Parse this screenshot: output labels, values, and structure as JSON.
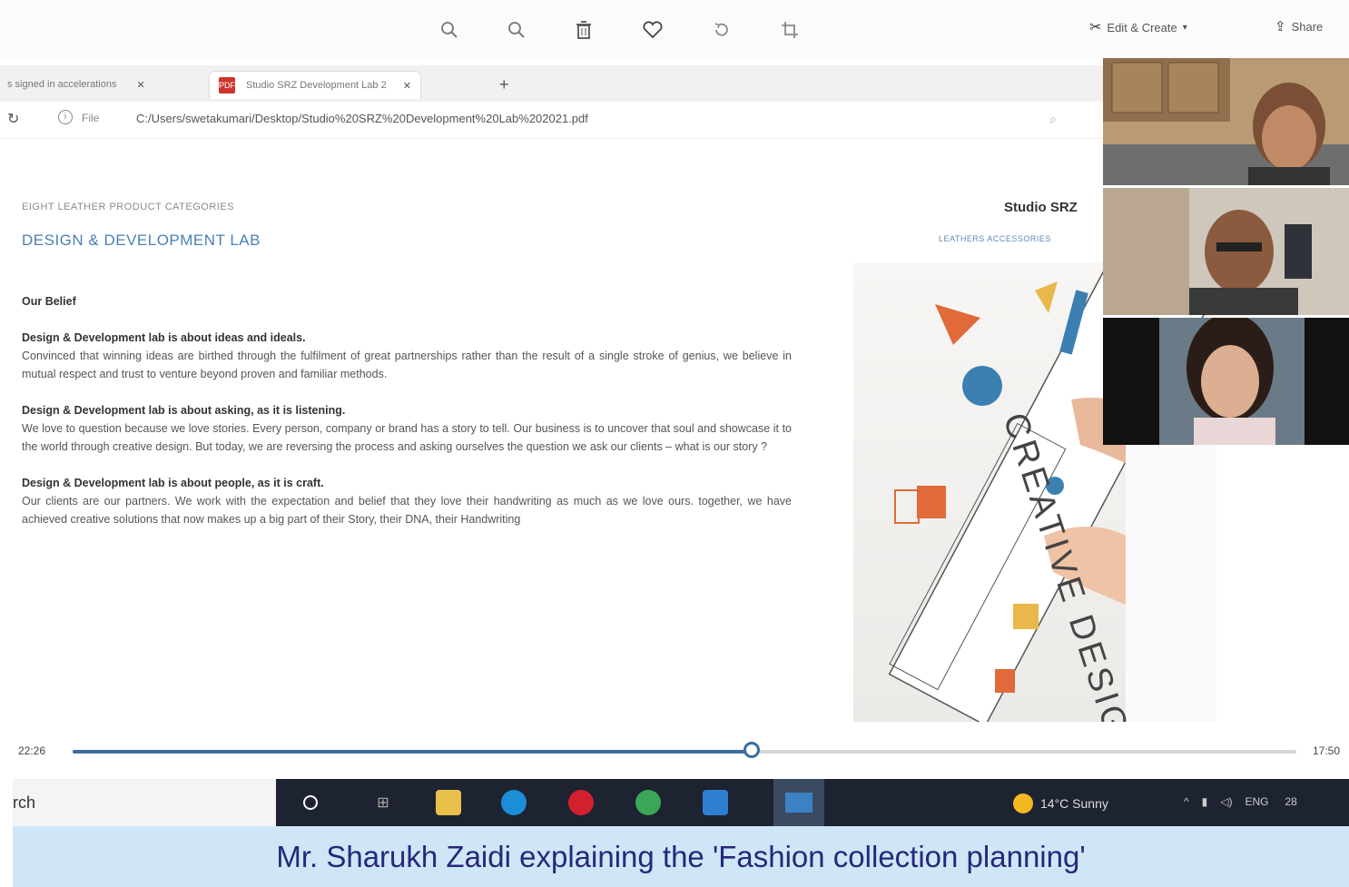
{
  "photos_toolbar": {
    "zoom_in_icon": "magnifier-plus-icon",
    "zoom_out_icon": "magnifier-minus-icon",
    "delete_icon": "trash-icon",
    "favorite_icon": "heart-icon",
    "rotate_icon": "rotate-icon",
    "crop_icon": "crop-icon",
    "edit_create_label": "Edit & Create",
    "share_label": "Share"
  },
  "browser": {
    "tab1_label": "s signed in accelerations",
    "tab2_label": "Studio SRZ Development Lab 2",
    "new_tab": "+",
    "file_label": "File",
    "url": "C:/Users/swetakumari/Desktop/Studio%20SRZ%20Development%20Lab%202021.pdf"
  },
  "pdf": {
    "category_label": "EIGHT LEATHER PRODUCT CATEGORIES",
    "lab_title": "DESIGN & DEVELOPMENT LAB",
    "studio_name": "Studio SRZ",
    "leathers_label": "LEATHERS ACCESSORIES",
    "belief_heading": "Our Belief",
    "p1_heading": "Design & Development lab is about ideas and ideals.",
    "p1_text": "Convinced that winning ideas are birthed through the fulfilment of great partnerships rather than the result of a single stroke of genius, we believe in mutual respect and trust to venture beyond proven and familiar methods.",
    "p2_heading": "Design & Development lab is about asking, as it is listening.",
    "p2_text": "We love to question because we love stories. Every person, company or brand has a story to tell. Our business is to uncover that soul and showcase it to the world through creative design. But today, we are reversing the process and asking ourselves the question we ask our clients – what is our story ?",
    "p3_heading": "Design & Development lab is about people, as it is craft.",
    "p3_text": "Our clients are our partners. We work with the expectation and belief that they love their handwriting as much as we love ours. together, we have achieved creative solutions that now makes up a big part of their Story, their DNA, their Handwriting",
    "illustration_text": "CREATIVE DESIGN"
  },
  "video": {
    "time_elapsed": "22:26",
    "time_total": "17:50",
    "progress": 0.555
  },
  "taskbar": {
    "search_text": "rch",
    "weather": "14°C  Sunny",
    "lang": "ENG",
    "date_fragment": "28"
  },
  "caption": "Mr. Sharukh Zaidi explaining the 'Fashion collection planning'"
}
